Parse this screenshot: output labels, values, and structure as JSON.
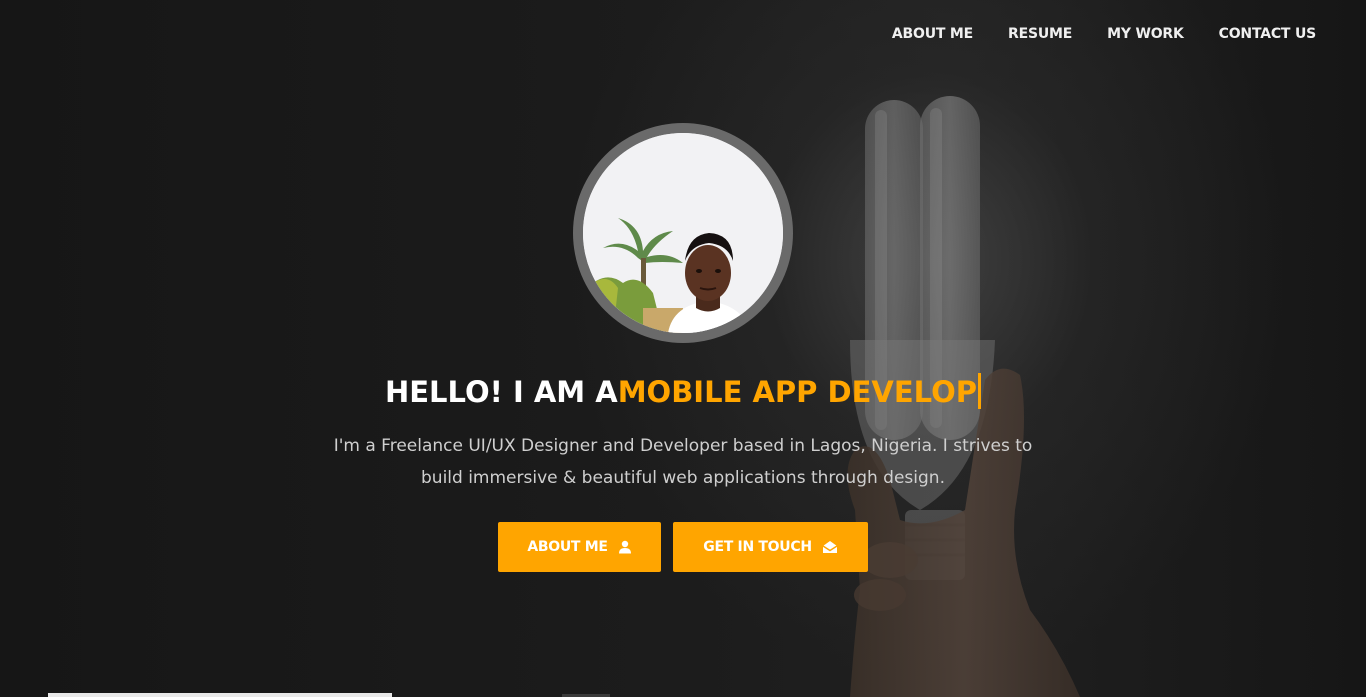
{
  "nav": {
    "items": [
      {
        "label": "ABOUT ME"
      },
      {
        "label": "RESUME"
      },
      {
        "label": "MY WORK"
      },
      {
        "label": "CONTACT US"
      }
    ]
  },
  "hero": {
    "headline_static": "HELLO! I AM A",
    "headline_typed": "MOBILE APP DEVELOP",
    "intro_line1": "I'm a Freelance UI/UX Designer and Developer based in Lagos, Nigeria. I strives to",
    "intro_line2": "build immersive & beautiful web applications through design.",
    "buttons": {
      "about_label": "ABOUT ME",
      "about_icon": "user-icon",
      "touch_label": "GET IN TOUCH",
      "touch_icon": "envelope-open-icon"
    }
  },
  "colors": {
    "accent": "#ffa500",
    "background": "#161616",
    "text": "#ffffff",
    "muted_text": "#cfcfcf"
  }
}
